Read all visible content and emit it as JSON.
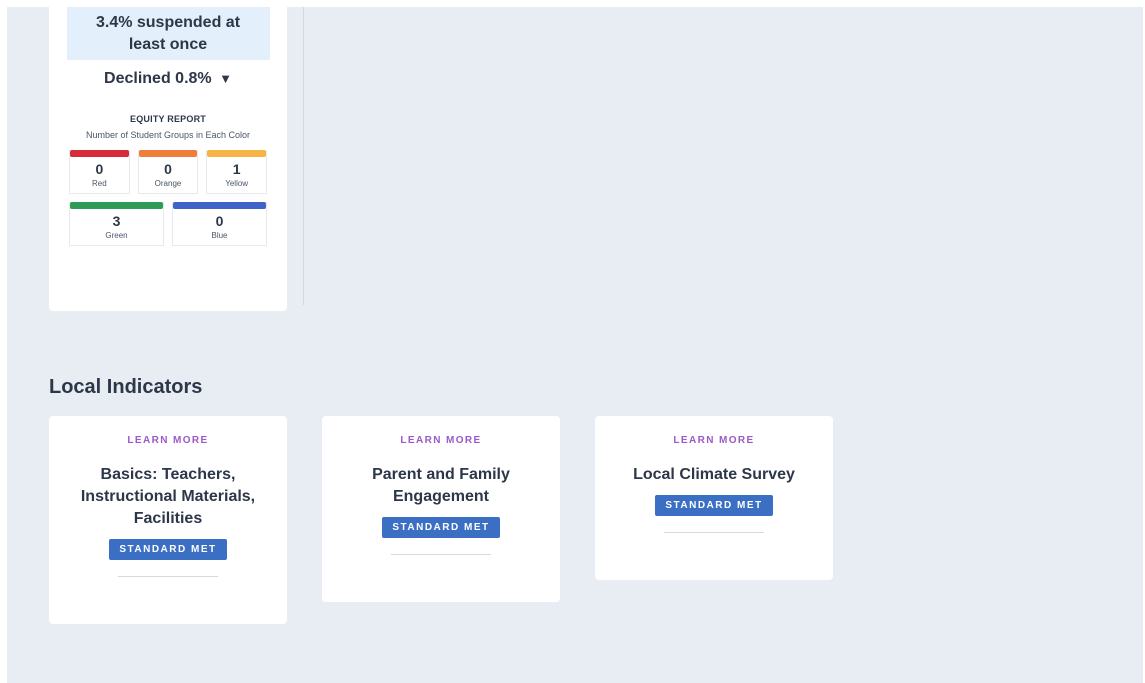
{
  "suspension": {
    "stat": "3.4% suspended at least once",
    "change": "Declined 0.8%",
    "arrow": "▼"
  },
  "equity_report": {
    "title": "EQUITY REPORT",
    "subtitle": "Number of Student Groups in Each Color",
    "colors": [
      {
        "label": "Red",
        "count": "0",
        "color": "#d62b38"
      },
      {
        "label": "Orange",
        "count": "0",
        "color": "#f07e3b"
      },
      {
        "label": "Yellow",
        "count": "1",
        "color": "#f7b444"
      },
      {
        "label": "Green",
        "count": "3",
        "color": "#2e9b57"
      },
      {
        "label": "Blue",
        "count": "0",
        "color": "#3f63c9"
      }
    ]
  },
  "local_indicators": {
    "title": "Local Indicators",
    "cards": [
      {
        "learn_more": "LEARN MORE",
        "title": "Basics: Teachers, Instructional Materials, Facilities",
        "status": "STANDARD MET"
      },
      {
        "learn_more": "LEARN MORE",
        "title": "Parent and Family Engagement",
        "status": "STANDARD MET"
      },
      {
        "learn_more": "LEARN MORE",
        "title": "Local Climate Survey",
        "status": "STANDARD MET"
      }
    ]
  }
}
